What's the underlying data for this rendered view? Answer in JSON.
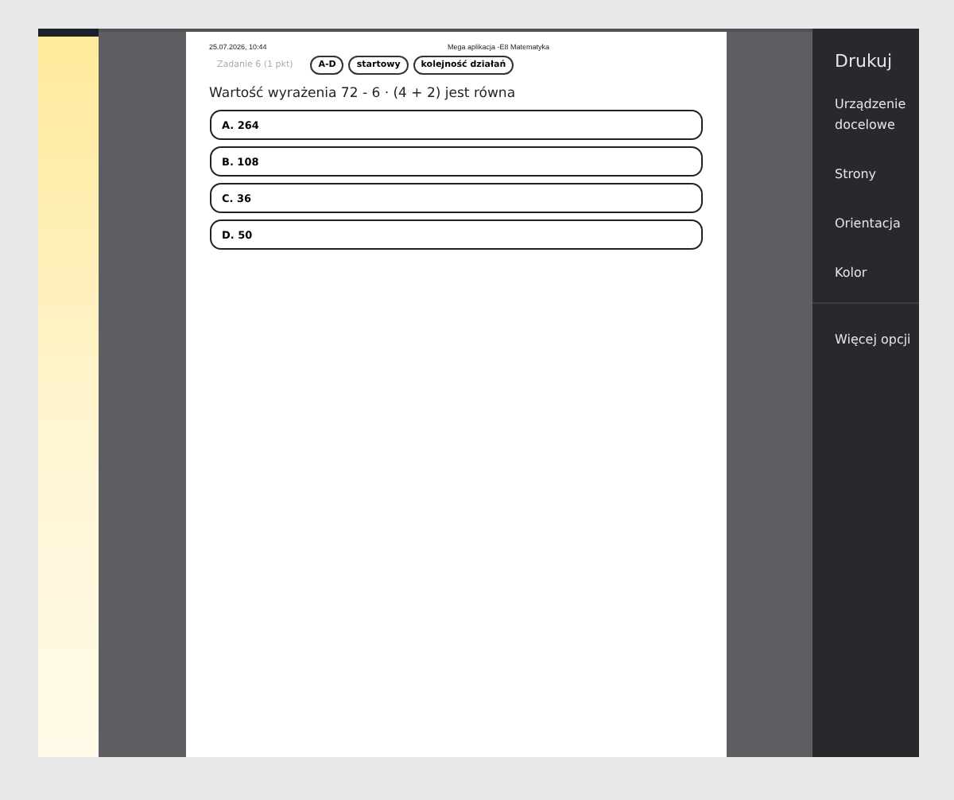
{
  "page": {
    "header_date": "25.07.2026, 10:44",
    "header_title": "Mega aplikacja -E8 Matematyka",
    "task_label": "Zadanie 6 (1 pkt)",
    "tags": [
      "A-D",
      "startowy",
      "kolejność działań"
    ],
    "question": "Wartość wyrażenia 72 - 6 · (4 + 2) jest równa",
    "answers": [
      "A. 264",
      "B. 108",
      "C. 36",
      "D. 50"
    ]
  },
  "print_panel": {
    "title": "Drukuj",
    "items": [
      "Urządzenie docelowe",
      "Strony",
      "Orientacja",
      "Kolor"
    ],
    "more": "Więcej opcji"
  }
}
